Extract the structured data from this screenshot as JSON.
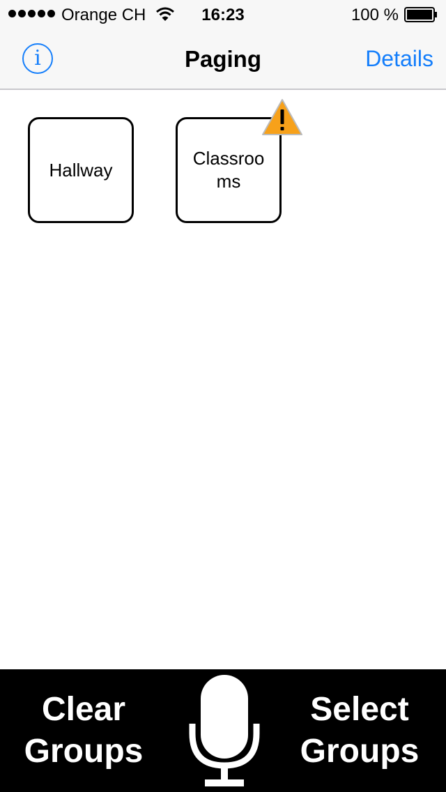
{
  "status_bar": {
    "carrier": "Orange CH",
    "time": "16:23",
    "battery_percent": "100 %",
    "signal_bars": 5,
    "icons": [
      "signal-dots-icon",
      "wifi-icon",
      "battery-icon"
    ]
  },
  "nav": {
    "title": "Paging",
    "info_glyph": "i",
    "details_label": "Details"
  },
  "groups": [
    {
      "label": "Hallway",
      "warning": false
    },
    {
      "label": "Classrooms",
      "warning": true,
      "warning_icon": "warning-triangle-icon"
    }
  ],
  "toolbar": {
    "clear": {
      "line1": "Clear",
      "line2": "Groups"
    },
    "select": {
      "line1": "Select",
      "line2": "Groups"
    },
    "mic_icon": "microphone-icon"
  },
  "colors": {
    "accent": "#147efb",
    "bar_background": "#f7f7f7",
    "toolbar_background": "#000000",
    "warning": "#f7a11a"
  }
}
